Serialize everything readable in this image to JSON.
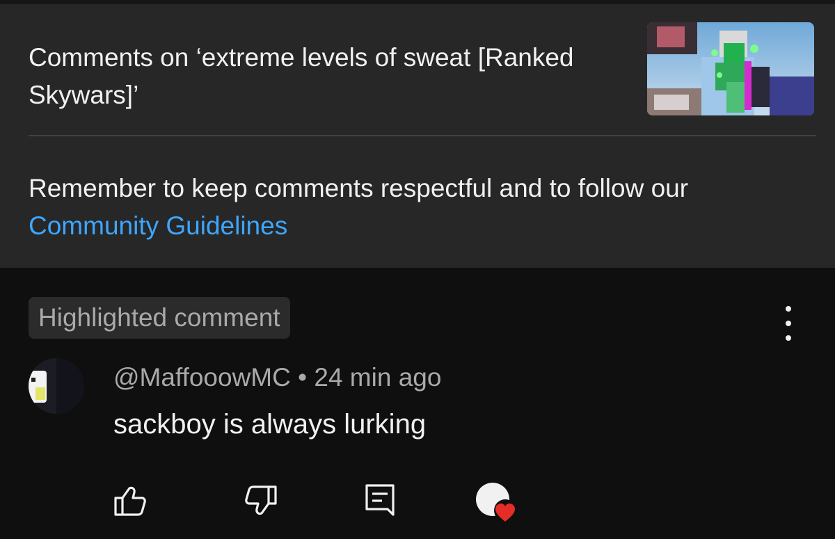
{
  "video": {
    "comments_title": "Comments on ‘extreme levels of sweat [Ranked Skywars]’",
    "thumbnail_icon": "video-thumbnail"
  },
  "notice": {
    "text": "Remember to keep comments respectful and to follow our ",
    "link_text": "Community Guidelines"
  },
  "comment": {
    "badge": "Highlighted comment",
    "author": "@MaffooowMC",
    "separator": " • ",
    "time": "24 min ago",
    "text": "sackboy is always lurking",
    "actions": [
      "like-icon",
      "dislike-icon",
      "reply-icon",
      "creator-heart-icon"
    ]
  },
  "colors": {
    "header_bg": "#272727",
    "page_bg": "#0f0f0f",
    "link": "#3ea6ff",
    "secondary_text": "#aaaaaa",
    "heart": "#e52d27"
  }
}
